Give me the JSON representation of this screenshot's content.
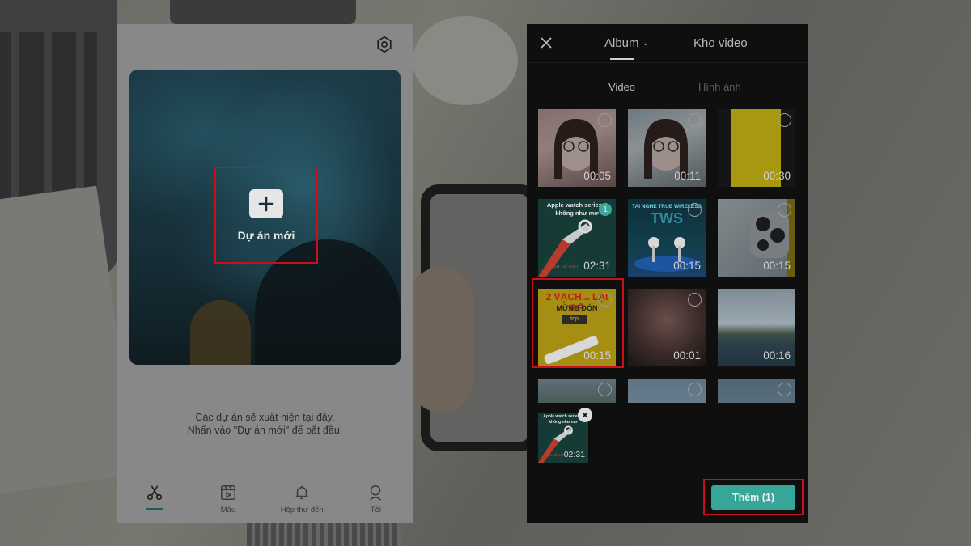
{
  "home": {
    "new_project_label": "Dự án mới",
    "empty_line_1": "Các dự án sẽ xuất hiện tại đây.",
    "empty_line_2": "Nhấn vào \"Dự án mới\" để bắt đầu!",
    "nav": [
      {
        "label": "",
        "icon": "scissors-icon",
        "active": true
      },
      {
        "label": "Mẫu",
        "icon": "template-icon"
      },
      {
        "label": "Hộp thư đến",
        "icon": "bell-icon"
      },
      {
        "label": "Tôi",
        "icon": "profile-icon"
      }
    ]
  },
  "picker": {
    "tabs": {
      "album": "Album",
      "kho_video": "Kho video"
    },
    "subtabs": {
      "video": "Video",
      "image": "Hình ảnh"
    },
    "thumbnails": [
      {
        "duration": "00:05",
        "selected": false
      },
      {
        "duration": "00:11",
        "selected": false
      },
      {
        "duration": "00:30",
        "selected": false
      },
      {
        "duration": "02:31",
        "selected": true,
        "badge": "1",
        "title": "Apple watch series 7 không như mơ",
        "caption": "Bạn có còn"
      },
      {
        "duration": "00:15",
        "selected": false,
        "title": "TAI NGHE TRUE WIRELESS",
        "caption": "TWS"
      },
      {
        "duration": "00:15",
        "selected": false
      },
      {
        "duration": "00:15",
        "selected": false,
        "title": "2 VẠCH... LẠI ĐẾ",
        "caption": "MỪNG ĐÓN",
        "tag": "top"
      },
      {
        "duration": "00:01",
        "selected": false
      },
      {
        "duration": "00:16",
        "selected": false
      },
      {
        "duration": "",
        "selected": false
      },
      {
        "duration": "",
        "selected": false
      },
      {
        "duration": "",
        "selected": false
      }
    ],
    "tray": {
      "title": "Apple watch series 7 không như mơ",
      "caption": "Bạn có còn",
      "duration": "02:31"
    },
    "add_button": "Thêm (1)"
  },
  "colors": {
    "accent": "#37a699",
    "highlight": "#c8101a"
  }
}
